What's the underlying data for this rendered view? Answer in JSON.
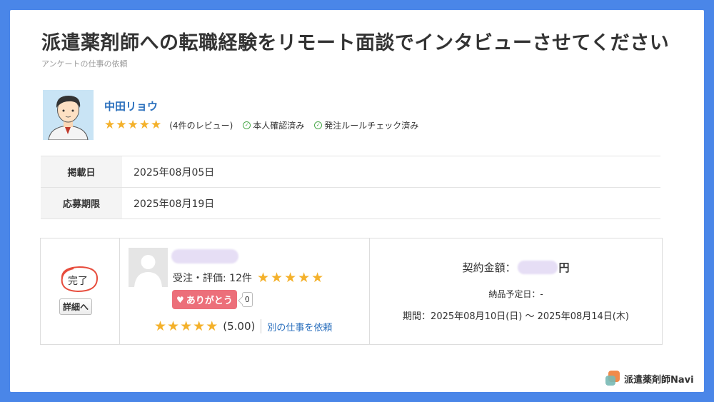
{
  "page": {
    "title": "派遣薬剤師への転職経験をリモート面談でインタビューさせてください",
    "subtitle": "アンケートの仕事の依頼"
  },
  "profile": {
    "name": "中田リョウ",
    "rating": 5,
    "reviews": "(4件のレビュー)",
    "badges": [
      "本人確認済み",
      "発注ルールチェック済み"
    ]
  },
  "info": [
    {
      "label": "掲載日",
      "value": "2025年08月05日"
    },
    {
      "label": "応募期限",
      "value": "2025年08月19日"
    }
  ],
  "order": {
    "status": "完了",
    "detail_button": "詳細へ",
    "worker": {
      "stats_label": "受注・評価: 12件",
      "stats_rating": 5,
      "thanks_label": "ありがとう",
      "thanks_count": "0",
      "rating": 5,
      "rating_value": "(5.00)",
      "rerequest_label": "別の仕事を依頼"
    },
    "contract": {
      "amount_label": "契約金額：",
      "amount_unit": "円",
      "delivery": "納品予定日：-",
      "period": "期間：2025年08月10日(日) 〜 2025年08月14日(木)"
    }
  },
  "brand": {
    "name": "派遣薬剤師Navi",
    "colors": {
      "orange": "#f08a4b",
      "teal": "#78b9b5"
    }
  },
  "colors": {
    "background": "#4a86e8",
    "star": "#f4b12b",
    "link": "#2a6fbd",
    "thanks": "#ec6f7a"
  }
}
